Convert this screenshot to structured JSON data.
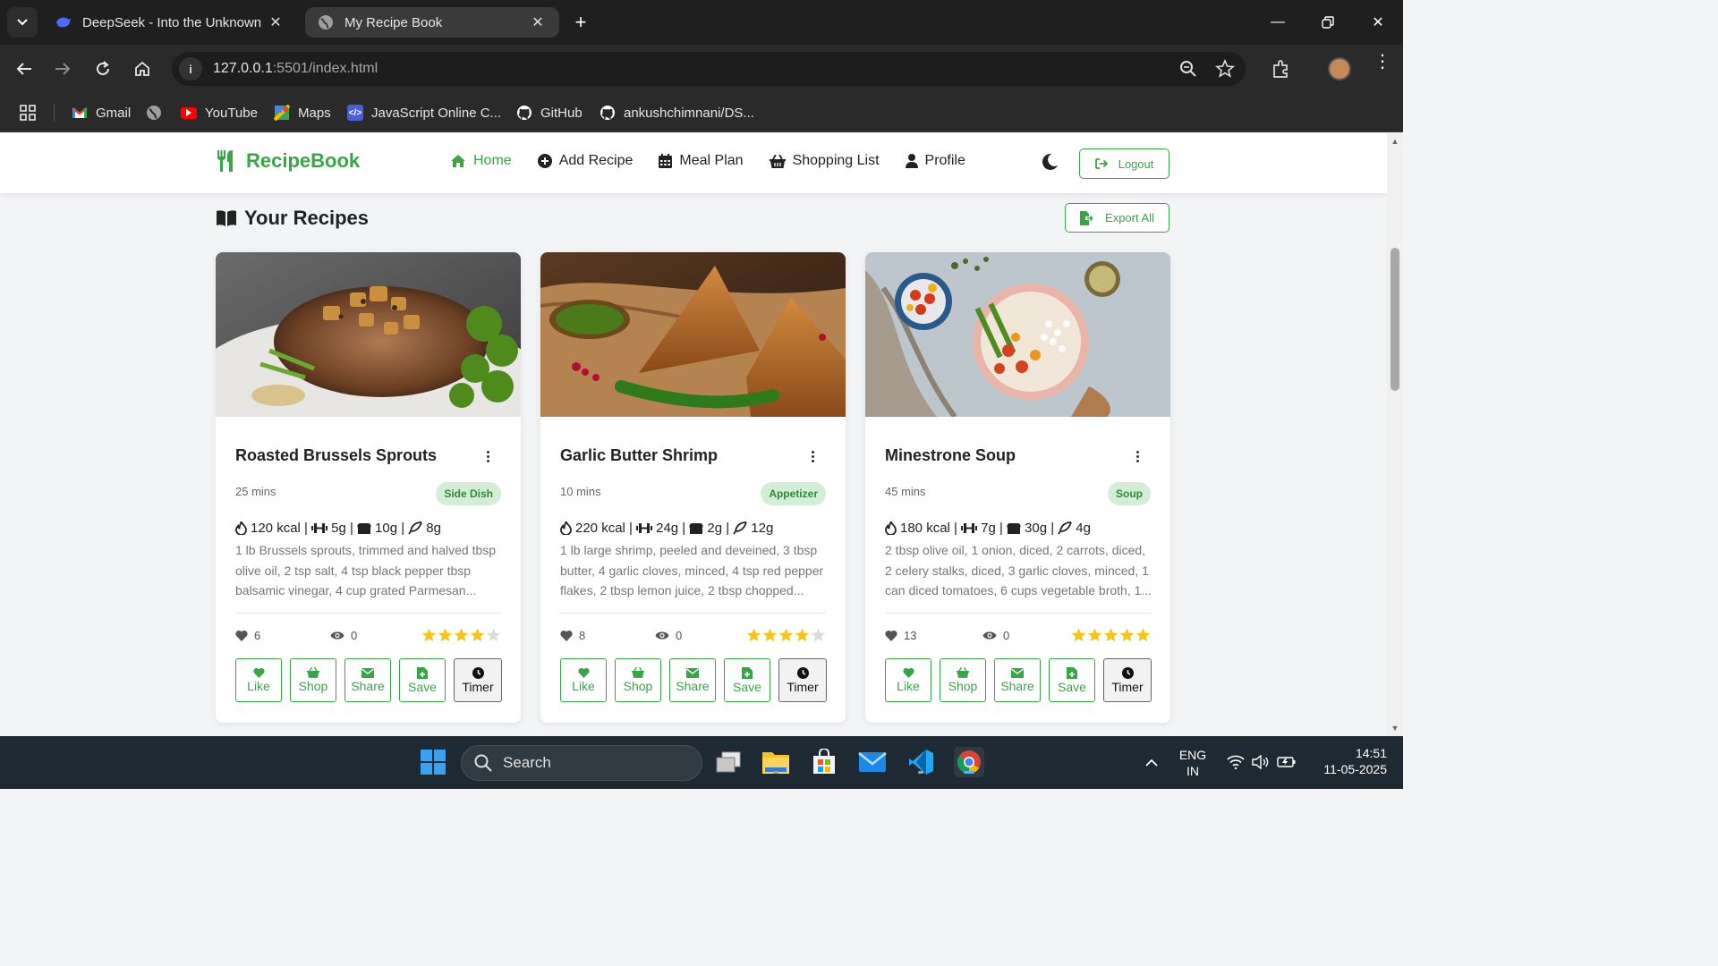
{
  "browser": {
    "tabs": [
      {
        "title": "DeepSeek - Into the Unknown",
        "active": false
      },
      {
        "title": "My Recipe Book",
        "active": true
      }
    ],
    "url_host": "127.0.0.1",
    "url_rest": ":5501/index.html",
    "bookmarks": [
      {
        "label": "Gmail"
      },
      {
        "label": "YouTube"
      },
      {
        "label": "Maps"
      },
      {
        "label": "JavaScript Online C..."
      },
      {
        "label": "GitHub"
      },
      {
        "label": "ankushchimnani/DS..."
      }
    ]
  },
  "app": {
    "brand": "RecipeBook",
    "nav": [
      {
        "label": "Home",
        "active": true
      },
      {
        "label": "Add Recipe",
        "active": false
      },
      {
        "label": "Meal Plan",
        "active": false
      },
      {
        "label": "Shopping List",
        "active": false
      },
      {
        "label": "Profile",
        "active": false
      }
    ],
    "logout_label": "Logout",
    "section_title": "Your Recipes",
    "export_label": "Export All",
    "colors": {
      "accent": "#3aa548",
      "badge_bg": "#d4edd6",
      "star": "#f5c518"
    }
  },
  "recipes": [
    {
      "title": "Roasted Brussels Sprouts",
      "time": "25 mins",
      "category": "Side Dish",
      "kcal": "120 kcal",
      "protein": "5g",
      "carbs": "10g",
      "fat": "8g",
      "ingredients": "1 lb Brussels sprouts, trimmed and halved tbsp olive oil, 2 tsp salt, 4 tsp black pepper tbsp balsamic vinegar, 4 cup grated Parmesan...",
      "likes": "6",
      "views": "0",
      "rating": 4
    },
    {
      "title": "Garlic Butter Shrimp",
      "time": "10 mins",
      "category": "Appetizer",
      "kcal": "220 kcal",
      "protein": "24g",
      "carbs": "2g",
      "fat": "12g",
      "ingredients": "1 lb large shrimp, peeled and deveined, 3 tbsp butter, 4 garlic cloves, minced, 4 tsp red pepper flakes, 2 tbsp lemon juice, 2 tbsp chopped...",
      "likes": "8",
      "views": "0",
      "rating": 4
    },
    {
      "title": "Minestrone Soup",
      "time": "45 mins",
      "category": "Soup",
      "kcal": "180 kcal",
      "protein": "7g",
      "carbs": "30g",
      "fat": "4g",
      "ingredients": "2 tbsp olive oil, 1 onion, diced, 2 carrots, diced, 2 celery stalks, diced, 3 garlic cloves, minced, 1 can diced tomatoes, 6 cups vegetable broth, 1...",
      "likes": "13",
      "views": "0",
      "rating": 5
    }
  ],
  "card_actions": [
    "Like",
    "Shop",
    "Share",
    "Save",
    "Timer"
  ],
  "taskbar": {
    "search_label": "Search",
    "lang_1": "ENG",
    "lang_2": "IN",
    "time": "14:51",
    "date": "11-05-2025"
  }
}
